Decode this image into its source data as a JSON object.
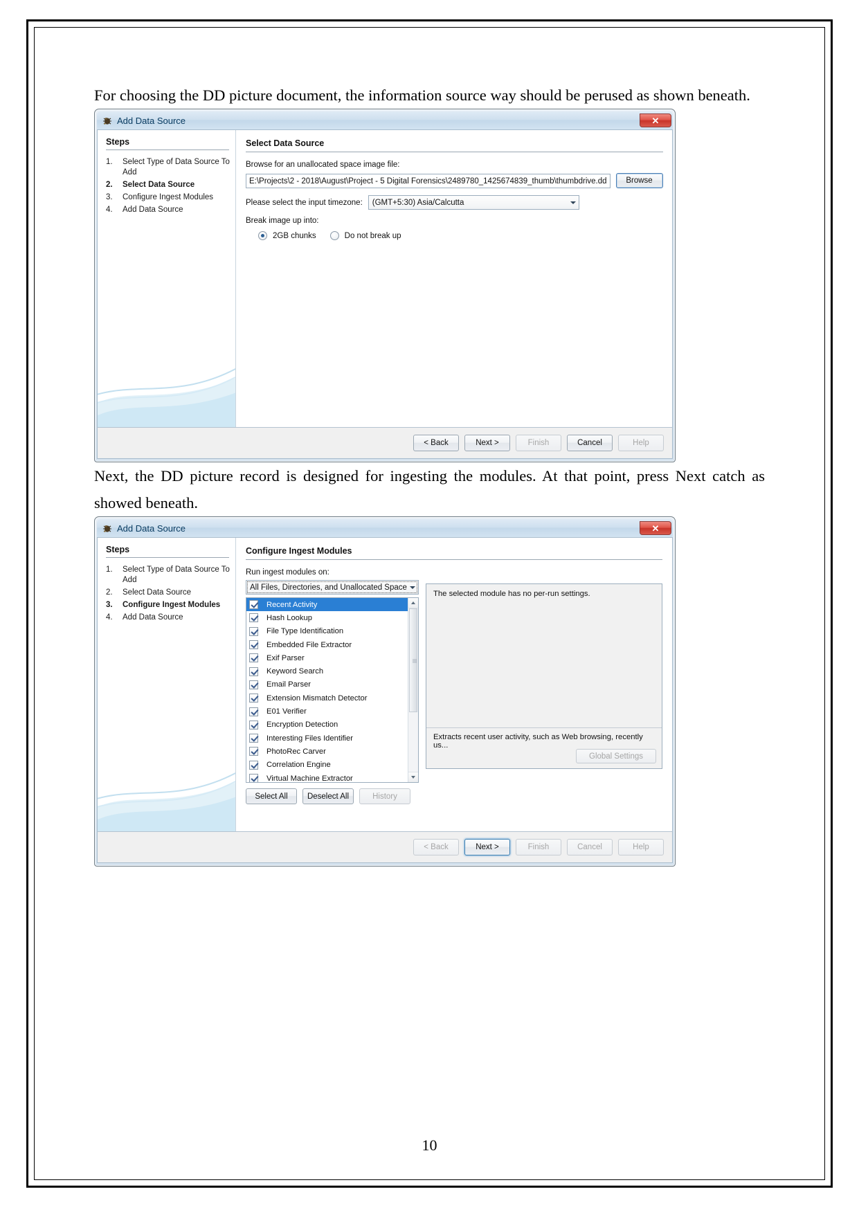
{
  "document": {
    "paragraph_1": "For choosing the DD picture document, the information source way should be perused as shown beneath.",
    "paragraph_2": "Next, the DD picture record is designed for ingesting the modules. At that point, press Next catch as showed beneath.",
    "page_number": "10"
  },
  "dialog1": {
    "title": "Add Data Source",
    "title_icon": "bug-icon",
    "close_label": "✕",
    "steps_heading": "Steps",
    "steps": [
      {
        "num": "1.",
        "label": "Select Type of Data Source To Add",
        "active": false
      },
      {
        "num": "2.",
        "label": "Select Data Source",
        "active": true
      },
      {
        "num": "3.",
        "label": "Configure Ingest Modules",
        "active": false
      },
      {
        "num": "4.",
        "label": "Add Data Source",
        "active": false
      }
    ],
    "panel_title": "Select Data Source",
    "browse_label": "Browse for an unallocated space image file:",
    "path_value": "E:\\Projects\\2 - 2018\\August\\Project - 5 Digital Forensics\\2489780_1425674839_thumb\\thumbdrive.dd",
    "browse_button": "Browse",
    "timezone_label": "Please select the input timezone:",
    "timezone_value": "(GMT+5:30) Asia/Calcutta",
    "break_label": "Break image up into:",
    "radio_chunks": "2GB chunks",
    "radio_nobreak": "Do not break up",
    "radio_selected": "2GB chunks",
    "footer": {
      "back": "< Back",
      "next": "Next >",
      "finish": "Finish",
      "cancel": "Cancel",
      "help": "Help"
    }
  },
  "dialog2": {
    "title": "Add Data Source",
    "title_icon": "bug-icon",
    "close_label": "✕",
    "steps_heading": "Steps",
    "steps": [
      {
        "num": "1.",
        "label": "Select Type of Data Source To Add",
        "active": false
      },
      {
        "num": "2.",
        "label": "Select Data Source",
        "active": false
      },
      {
        "num": "3.",
        "label": "Configure Ingest Modules",
        "active": true
      },
      {
        "num": "4.",
        "label": "Add Data Source",
        "active": false
      }
    ],
    "panel_title": "Configure Ingest Modules",
    "run_on_label": "Run ingest modules on:",
    "run_on_value": "All Files, Directories, and Unallocated Space",
    "modules": [
      {
        "name": "Recent Activity",
        "checked": true,
        "selected": true
      },
      {
        "name": "Hash Lookup",
        "checked": true,
        "selected": false
      },
      {
        "name": "File Type Identification",
        "checked": true,
        "selected": false
      },
      {
        "name": "Embedded File Extractor",
        "checked": true,
        "selected": false
      },
      {
        "name": "Exif Parser",
        "checked": true,
        "selected": false
      },
      {
        "name": "Keyword Search",
        "checked": true,
        "selected": false
      },
      {
        "name": "Email Parser",
        "checked": true,
        "selected": false
      },
      {
        "name": "Extension Mismatch Detector",
        "checked": true,
        "selected": false
      },
      {
        "name": "E01 Verifier",
        "checked": true,
        "selected": false
      },
      {
        "name": "Encryption Detection",
        "checked": true,
        "selected": false
      },
      {
        "name": "Interesting Files Identifier",
        "checked": true,
        "selected": false
      },
      {
        "name": "PhotoRec Carver",
        "checked": true,
        "selected": false
      },
      {
        "name": "Correlation Engine",
        "checked": true,
        "selected": false
      },
      {
        "name": "Virtual Machine Extractor",
        "checked": true,
        "selected": false
      }
    ],
    "select_all": "Select All",
    "deselect_all": "Deselect All",
    "history": "History",
    "no_settings_text": "The selected module has no per-run settings.",
    "module_description": "Extracts recent user activity, such as Web browsing, recently us...",
    "global_settings": "Global Settings",
    "footer": {
      "back": "< Back",
      "next": "Next >",
      "finish": "Finish",
      "cancel": "Cancel",
      "help": "Help"
    }
  }
}
